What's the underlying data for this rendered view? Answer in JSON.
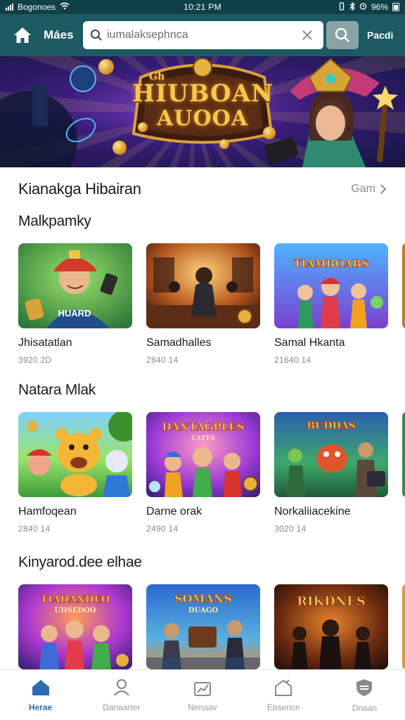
{
  "status_bar": {
    "carrier": "Bogonoes",
    "time": "10:21 PM",
    "battery": "96%"
  },
  "app_bar": {
    "title": "Máes",
    "search_placeholder": "iumalaksephnca",
    "right_link": "Pacdi"
  },
  "banner": {
    "tag": "Gh",
    "title_line1": "HIUBOAN",
    "title_line2": "AUOOA"
  },
  "main": {
    "heading": "Kianakga Hibairan",
    "see_all": "Gam"
  },
  "sections": [
    {
      "title": "Malkpamky",
      "cards": [
        {
          "title": "Jhisatatlan",
          "meta": "3920 2D"
        },
        {
          "title": "Samadhalles",
          "meta": "2840 14"
        },
        {
          "title": "Samal Hkanta",
          "meta": "21640 14"
        }
      ]
    },
    {
      "title": "Natara Mlak",
      "cards": [
        {
          "title": "Hamfoqean",
          "meta": "2840 14"
        },
        {
          "title": "Darne orak",
          "meta": "2490 14"
        },
        {
          "title": "Norkaliiacekine",
          "meta": "3020 14"
        }
      ]
    },
    {
      "title": "Kinyarod.dee elhae",
      "cards": [
        {
          "title": "",
          "meta": ""
        },
        {
          "title": "",
          "meta": ""
        },
        {
          "title": "",
          "meta": ""
        }
      ]
    }
  ],
  "thumb_text": {
    "s1c1": "HUARD",
    "s1c3": "TIAMBOABS",
    "s2c2_line1": "DANTAGPLES",
    "s2c2_line2": "CATES",
    "s2c3": "BUDDAS",
    "s3c1_line1": "TIADANDEO",
    "s3c1_line2": "UHSEDOO",
    "s3c2_line1": "SOMANS",
    "s3c2_line2": "DUAGO",
    "s3c3": "RIKDNES"
  },
  "bottom_nav": [
    {
      "label": "Herae",
      "icon": "home-icon",
      "active": true
    },
    {
      "label": "Danaarter",
      "icon": "person-icon",
      "active": false
    },
    {
      "label": "Nenaav",
      "icon": "chart-icon",
      "active": false
    },
    {
      "label": "Ebsence",
      "icon": "house-outline-icon",
      "active": false
    },
    {
      "label": "Dnaan",
      "icon": "shield-icon",
      "active": false
    }
  ],
  "colors": {
    "app_bar": "#1b5a62",
    "status_bar": "#0f3f47",
    "accent": "#2d6bb0"
  }
}
